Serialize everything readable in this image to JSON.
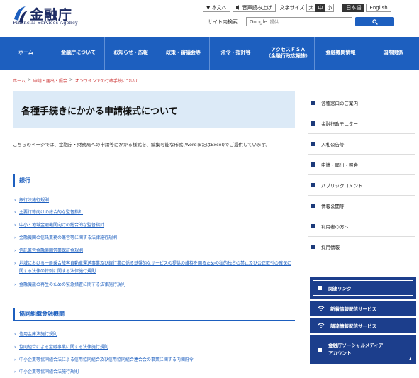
{
  "header": {
    "logo_jp": "金融庁",
    "logo_en": "Financial Services Agency",
    "body_text_label": "▼ 本文へ",
    "voice_label": "音声読み上げ",
    "font_size_label": "文字サイズ",
    "font_large": "大",
    "font_medium": "中",
    "font_small": "小",
    "lang_jp": "日本語",
    "lang_en": "English",
    "search_label": "サイト内検索",
    "search_placeholder": "Google 提供",
    "search_google": "Google",
    "search_ph_text": "提供"
  },
  "nav": {
    "items": [
      "ホーム",
      "金融庁について",
      "お知らせ・広報",
      "政策・審議会等",
      "法令・指針等",
      "アクセスＦＳＡ\n（金融行政広報誌）",
      "金融機関情報",
      "国際関係"
    ]
  },
  "breadcrumb": [
    "ホーム",
    "申請・届出・照会",
    "オンラインでの行政手続について"
  ],
  "page_title": "各種手続きにかかる申請様式について",
  "intro": "こちらのページでは、金融庁・財務局への申請等にかかる様式を、編集可能な形式(WordまたはExcel)でご提供しています。",
  "sections": [
    {
      "heading": "銀行",
      "links": [
        "銀行法施行規則",
        "主要行等向けの総合的な監督指針",
        "中小・地域金融機関向けの総合的な監督指針",
        "金融機関の信託業務の兼営等に関する法律施行規則",
        "信託兼営金融機関営業保証金規則",
        "地域における一般乗合旅客自動車運送事業及び銀行業に係る基盤的なサービスの提供の維持を図るための私的独占の禁止及び公正取引の確保に関する法律の特例に関する法律施行規則",
        "金融機能の再生のための緊急措置に関する法律施行規則"
      ]
    },
    {
      "heading": "協同組織金融機関",
      "links": [
        "信用金庫法施行規則",
        "協同組合による金融事業に関する法律施行規則",
        "中小企業等協同組合法による信用協同組合及び信用協同組合連合会の事業に関する内閣府令",
        "中小企業等協同組合法施行規則"
      ]
    }
  ],
  "sidebar": {
    "items": [
      "各種窓口のご案内",
      "金融行政モニター",
      "入札公告等",
      "申請・届出・照会",
      "パブリックコメント",
      "情報公開等",
      "利用者の方へ",
      "採用情報"
    ],
    "buttons": [
      "関連リンク",
      "新着情報配信サービス",
      "調達情報配信サービス",
      "金融庁ソーシャルメディア\nアカウント"
    ]
  }
}
